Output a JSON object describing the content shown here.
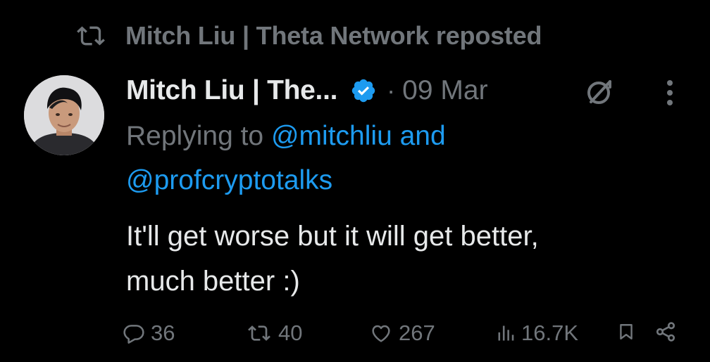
{
  "repost": {
    "icon": "repost-icon",
    "text": "Mitch Liu | Theta Network reposted"
  },
  "tweet": {
    "author_name": "Mitch Liu | The...",
    "verified": true,
    "separator": "·",
    "timestamp": "09 Mar",
    "reply_prefix": "Replying to",
    "mentions": [
      "@mitchliu",
      "@profcryptotalks"
    ],
    "mention_joiner": "and",
    "text_line1": "It'll get worse but it will get better,",
    "text_line2": "much better :)"
  },
  "actions": {
    "replies": "36",
    "reposts": "40",
    "likes": "267",
    "views": "16.7K"
  },
  "colors": {
    "background": "#000000",
    "primary_text": "#e7e9ea",
    "secondary_text": "#71767b",
    "accent": "#1d9bf0"
  }
}
